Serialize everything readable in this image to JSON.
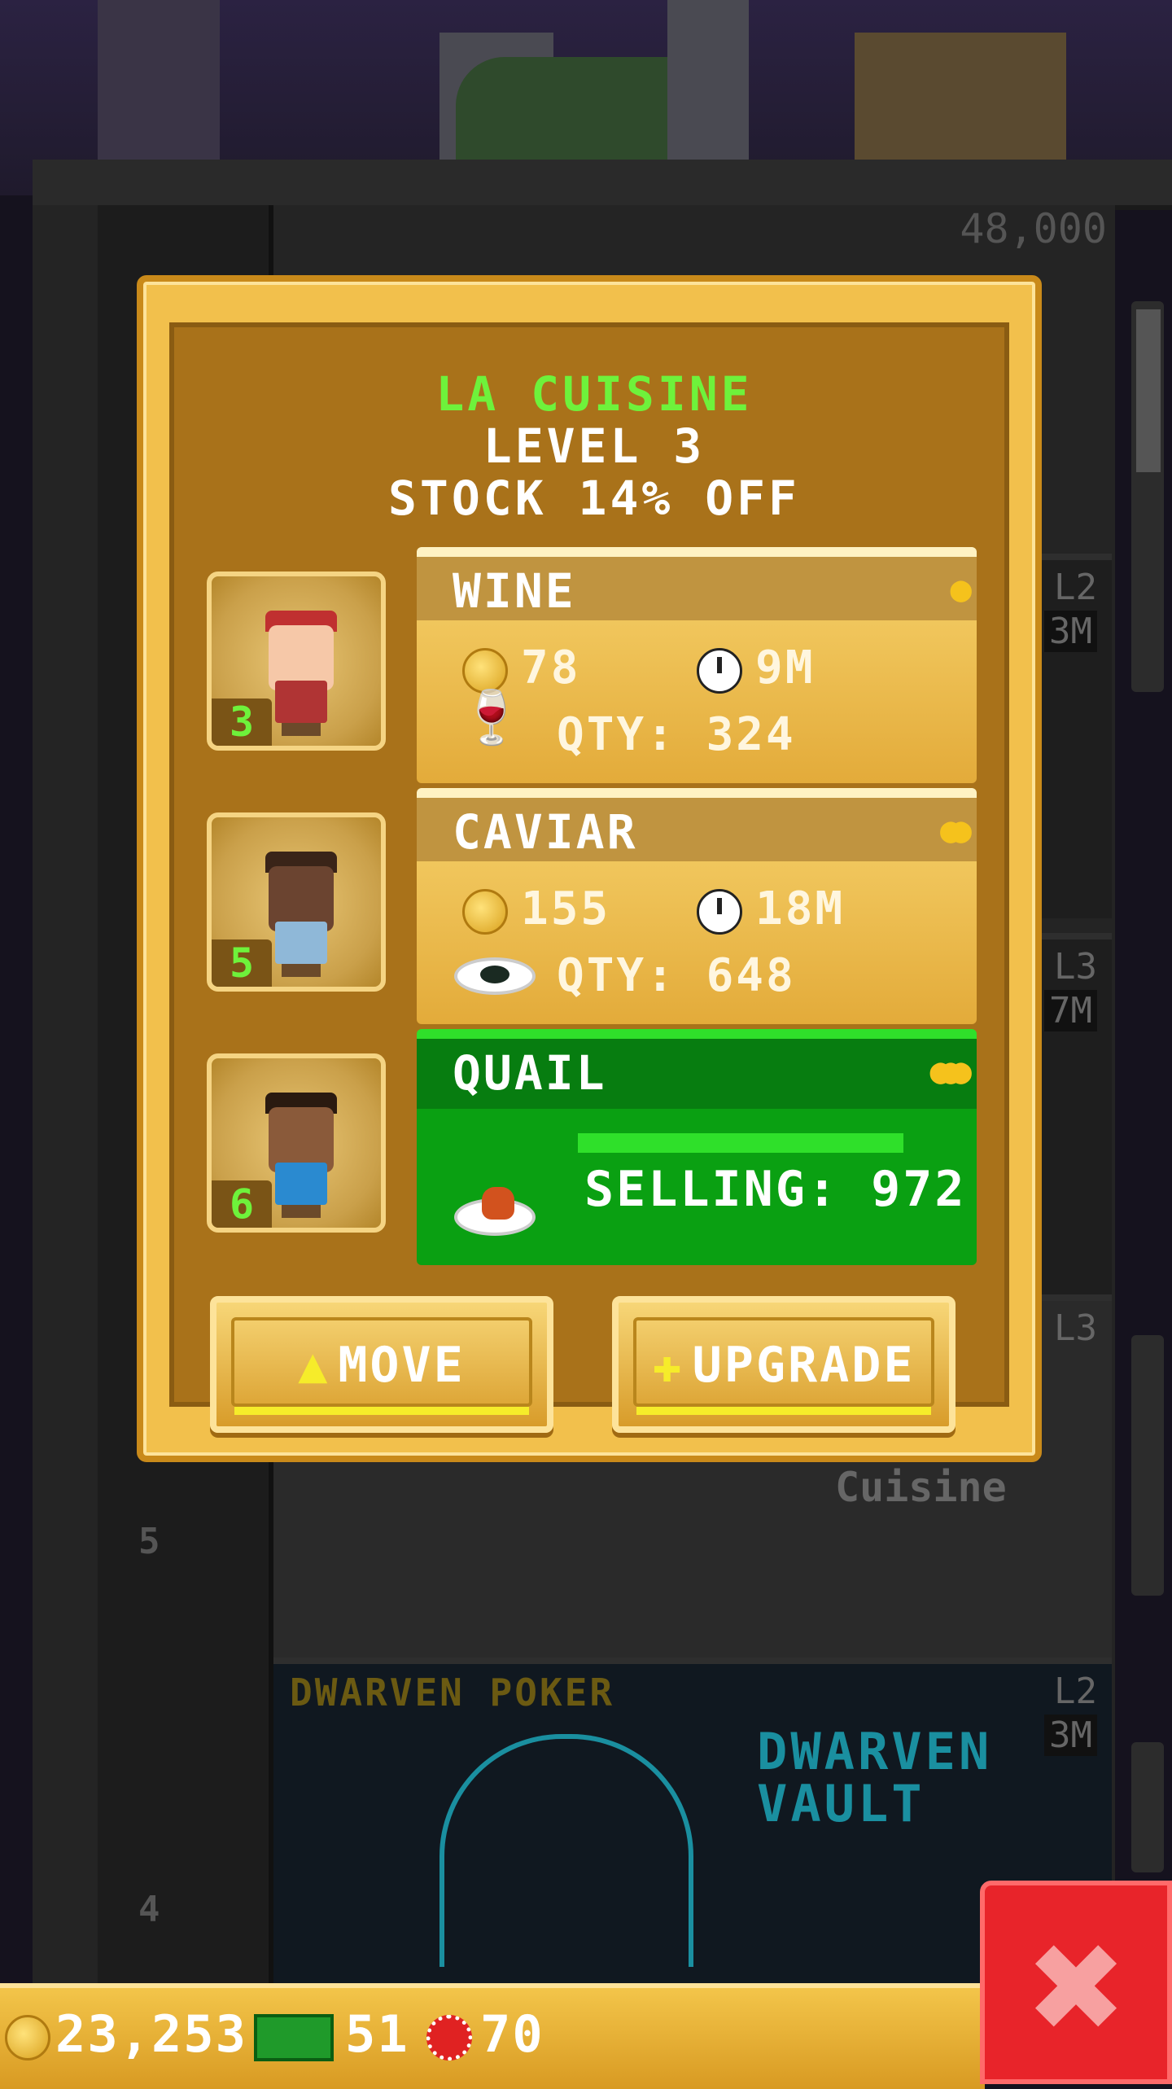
{
  "dialog": {
    "title": "LA CUISINE",
    "level": "LEVEL 3",
    "stock_discount": "STOCK 14% OFF"
  },
  "workers": [
    {
      "skill": "3",
      "hair": "#c03030",
      "skin": "#f6c8a8",
      "shirt": "#b03434"
    },
    {
      "skill": "5",
      "hair": "#3a2418",
      "skin": "#6b4430",
      "shirt": "#8fb8d8"
    },
    {
      "skill": "6",
      "hair": "#2a1a10",
      "skin": "#8a5a3a",
      "shirt": "#2a8ad0"
    }
  ],
  "items": [
    {
      "name": "WINE",
      "cost": "78",
      "time": "9M",
      "qty_label": "QTY: 324",
      "coin_tier": 1,
      "icon": "wine-glass-icon"
    },
    {
      "name": "CAVIAR",
      "cost": "155",
      "time": "18M",
      "qty_label": "QTY: 648",
      "coin_tier": 2,
      "icon": "caviar-plate-icon"
    },
    {
      "name": "QUAIL",
      "selling_label": "SELLING: 972",
      "progress": 1.0,
      "coin_tier": 3,
      "icon": "quail-plate-icon"
    }
  ],
  "buttons": {
    "move": "MOVE",
    "upgrade": "UPGRADE"
  },
  "resources": {
    "coins": "23,253",
    "bux": "51",
    "chips": "70"
  },
  "background": {
    "top_value": "48,000",
    "floors": [
      {
        "level": "L2",
        "time": "3M",
        "label": ""
      },
      {
        "level": "L3",
        "time": "7M",
        "label": ""
      },
      {
        "level": "L3",
        "time": "",
        "label": ""
      },
      {
        "level": "L2",
        "time": "3M",
        "label": "DWARVEN POKER"
      }
    ],
    "floor_numbers": [
      "5",
      "4"
    ],
    "neon_sign": "DWARVEN VAULT",
    "cuisine_sign": "Cuisine"
  },
  "colors": {
    "title_green": "#6ef23b",
    "gold": "#f2c04c",
    "selling_green": "#0aa012",
    "close_red": "#e8242a"
  }
}
